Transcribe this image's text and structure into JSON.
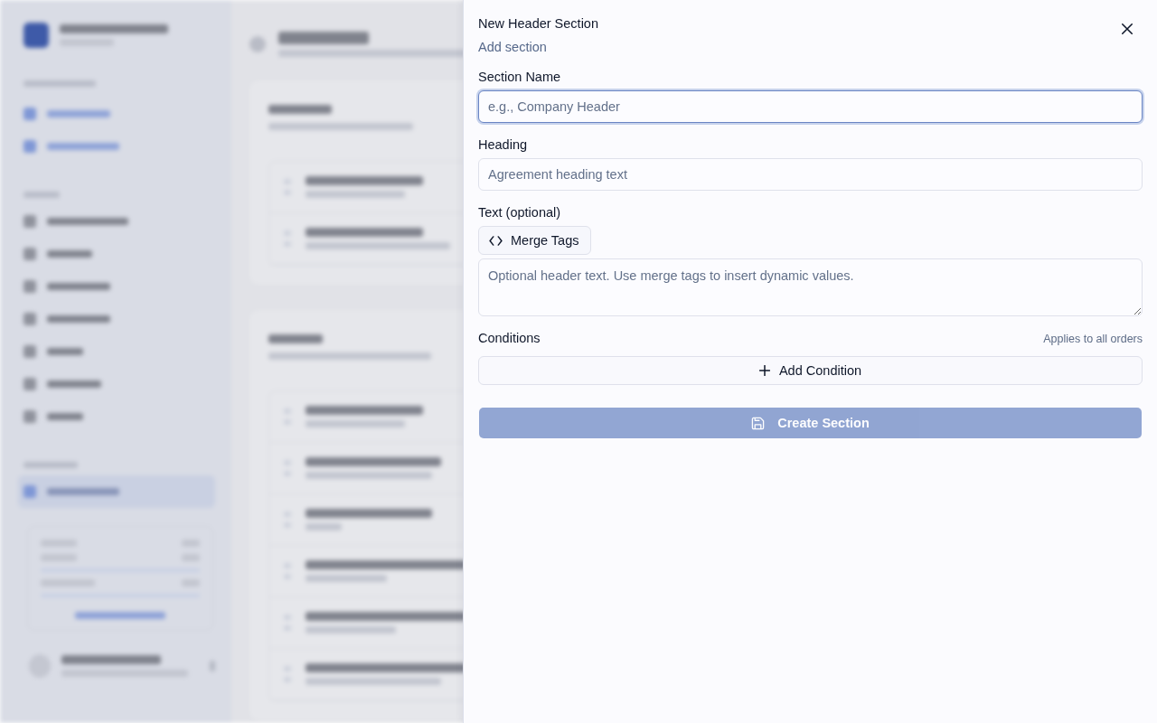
{
  "panel": {
    "title": "New Header Section",
    "subtitle": "Add section",
    "fields": [
      {
        "kind": "input",
        "label": "Section Name",
        "placeholder": "e.g., Company Header",
        "focused": true
      },
      {
        "kind": "input",
        "label": "Heading",
        "placeholder": "Agreement heading text",
        "focused": false
      },
      {
        "kind": "textarea",
        "label": "Text (optional)",
        "toolbar_button": "Merge Tags",
        "placeholder": "Optional header text. Use merge tags to insert dynamic values.",
        "focused": false
      }
    ],
    "conditions": {
      "label": "Conditions",
      "note": "Applies to all orders",
      "add_button": "Add Condition"
    },
    "submit": {
      "label": "Create Section",
      "disabled": true
    }
  }
}
